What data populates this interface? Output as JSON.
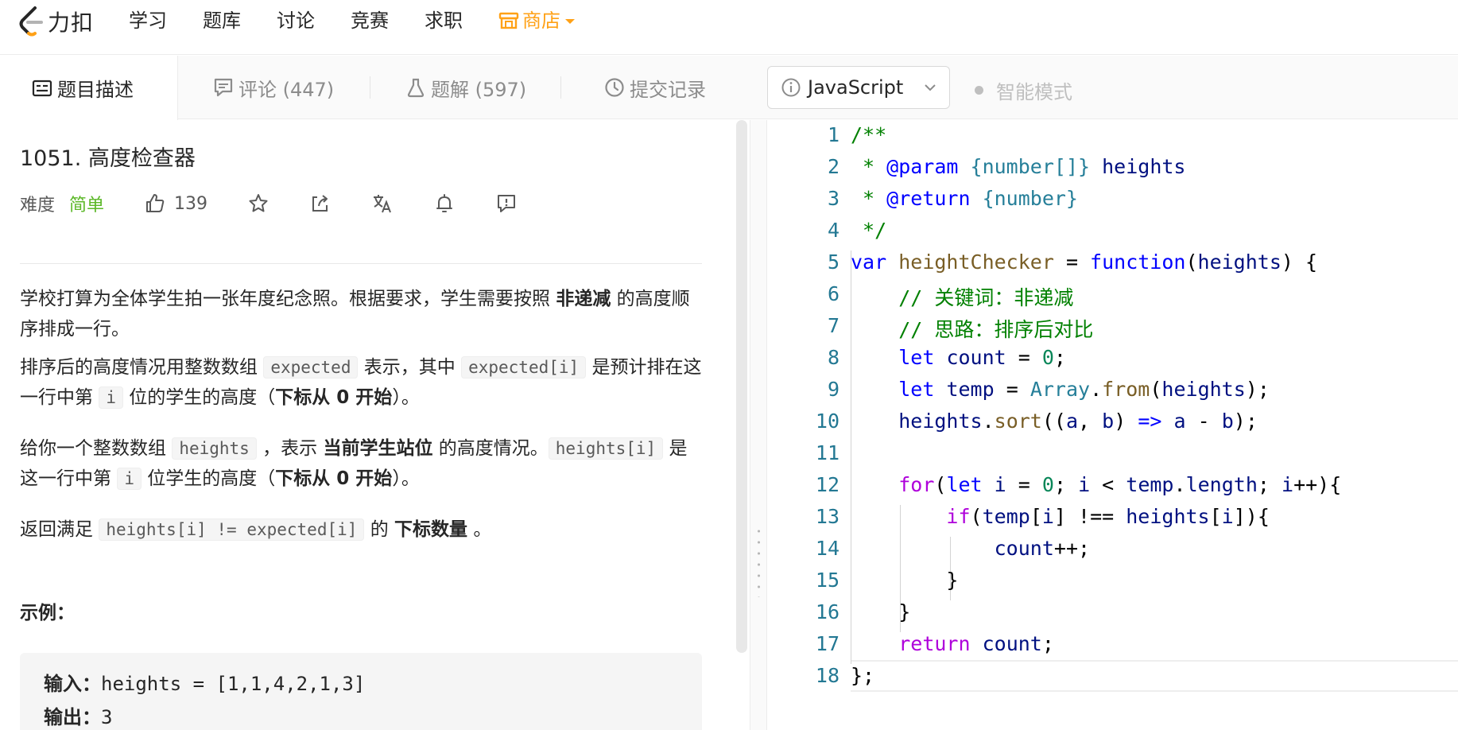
{
  "nav": {
    "logo_text": "力扣",
    "links": [
      "学习",
      "题库",
      "讨论",
      "竞赛",
      "求职"
    ],
    "store_label": "商店"
  },
  "tabs": {
    "description": "题目描述",
    "comments": "评论 (447)",
    "solutions": "题解 (597)",
    "submissions": "提交记录"
  },
  "editor_toolbar": {
    "language": "JavaScript",
    "smart_mode": "智能模式"
  },
  "problem": {
    "title": "1051. 高度检查器",
    "difficulty_label": "难度",
    "difficulty": "简单",
    "likes": "139",
    "p1_a": "学校打算为全体学生拍一张年度纪念照。根据要求，学生需要按照 ",
    "p1_b": "非递减",
    "p1_c": " 的高度顺序排成一行。",
    "p2_a": "排序后的高度情况用整数数组 ",
    "p2_code1": "expected",
    "p2_b": " 表示，其中 ",
    "p2_code2": "expected[i]",
    "p2_c": " 是预计排在这一行中第 ",
    "p2_code3": "i",
    "p2_d": " 位的学生的高度（",
    "p2_bold": "下标从 0 开始",
    "p2_e": "）。",
    "p3_a": "给你一个整数数组 ",
    "p3_code1": "heights",
    "p3_b": " ，表示 ",
    "p3_bold": "当前学生站位",
    "p3_c": " 的高度情况。",
    "p3_code2": "heights[i]",
    "p3_d": " 是这一行中第 ",
    "p3_code3": "i",
    "p3_e": " 位学生的高度（",
    "p3_bold2": "下标从 0 开始",
    "p3_f": "）。",
    "p4_a": "返回满足 ",
    "p4_code": "heights[i] != expected[i]",
    "p4_b": " 的 ",
    "p4_bold": "下标数量",
    "p4_c": " 。",
    "example_title": "示例：",
    "example_input_label": "输入：",
    "example_input": "heights = [1,1,4,2,1,3]",
    "example_output_label": "输出：",
    "example_output": "3"
  },
  "code": {
    "line_numbers": [
      "1",
      "2",
      "3",
      "4",
      "5",
      "6",
      "7",
      "8",
      "9",
      "10",
      "11",
      "12",
      "13",
      "14",
      "15",
      "16",
      "17",
      "18"
    ],
    "t": {
      "l1": "/**",
      "l2_star": " * ",
      "l2_tag": "@param",
      "l2_type": "{number[]}",
      "l2_name": "heights",
      "l3_star": " * ",
      "l3_tag": "@return",
      "l3_type": "{number}",
      "l4": " */",
      "kw_var": "var",
      "fn_name": "heightChecker",
      "eq": " = ",
      "kw_function": "function",
      "p_open": "(",
      "param": "heights",
      "p_close": ") {",
      "c6": "// 关键词：非递减",
      "c7": "// 思路：排序后对比",
      "kw_let": "let",
      "v_count": "count",
      "assign": " = ",
      "n0": "0",
      "semi": ";",
      "v_temp": "temp",
      "cls_array": "Array",
      "dot": ".",
      "fn_from": "from",
      "l9_tail": ");",
      "v_heights": "heights",
      "fn_sort": "sort",
      "l10_open": "((",
      "v_a": "a",
      "comma": ", ",
      "v_b": "b",
      "l10_mid": ") ",
      "arrow": "=>",
      "minus": " - ",
      "l10_tail": ");",
      "kw_for": "for",
      "v_i": "i",
      "lt": " < ",
      "prop_length": "length",
      "l12_tail": "++){",
      "kw_if": "if",
      "idx": "[",
      "neq": "] !== ",
      "l13_tail": "]){",
      "l14_tail": "++;",
      "brace": "}",
      "kw_return": "return",
      "l18": "};"
    }
  },
  "colors": {
    "accent": "#ffa116",
    "easy": "#5ab726",
    "line_number": "#237893",
    "comment": "#008000",
    "keyword": "#0000ff",
    "control": "#af00db"
  }
}
